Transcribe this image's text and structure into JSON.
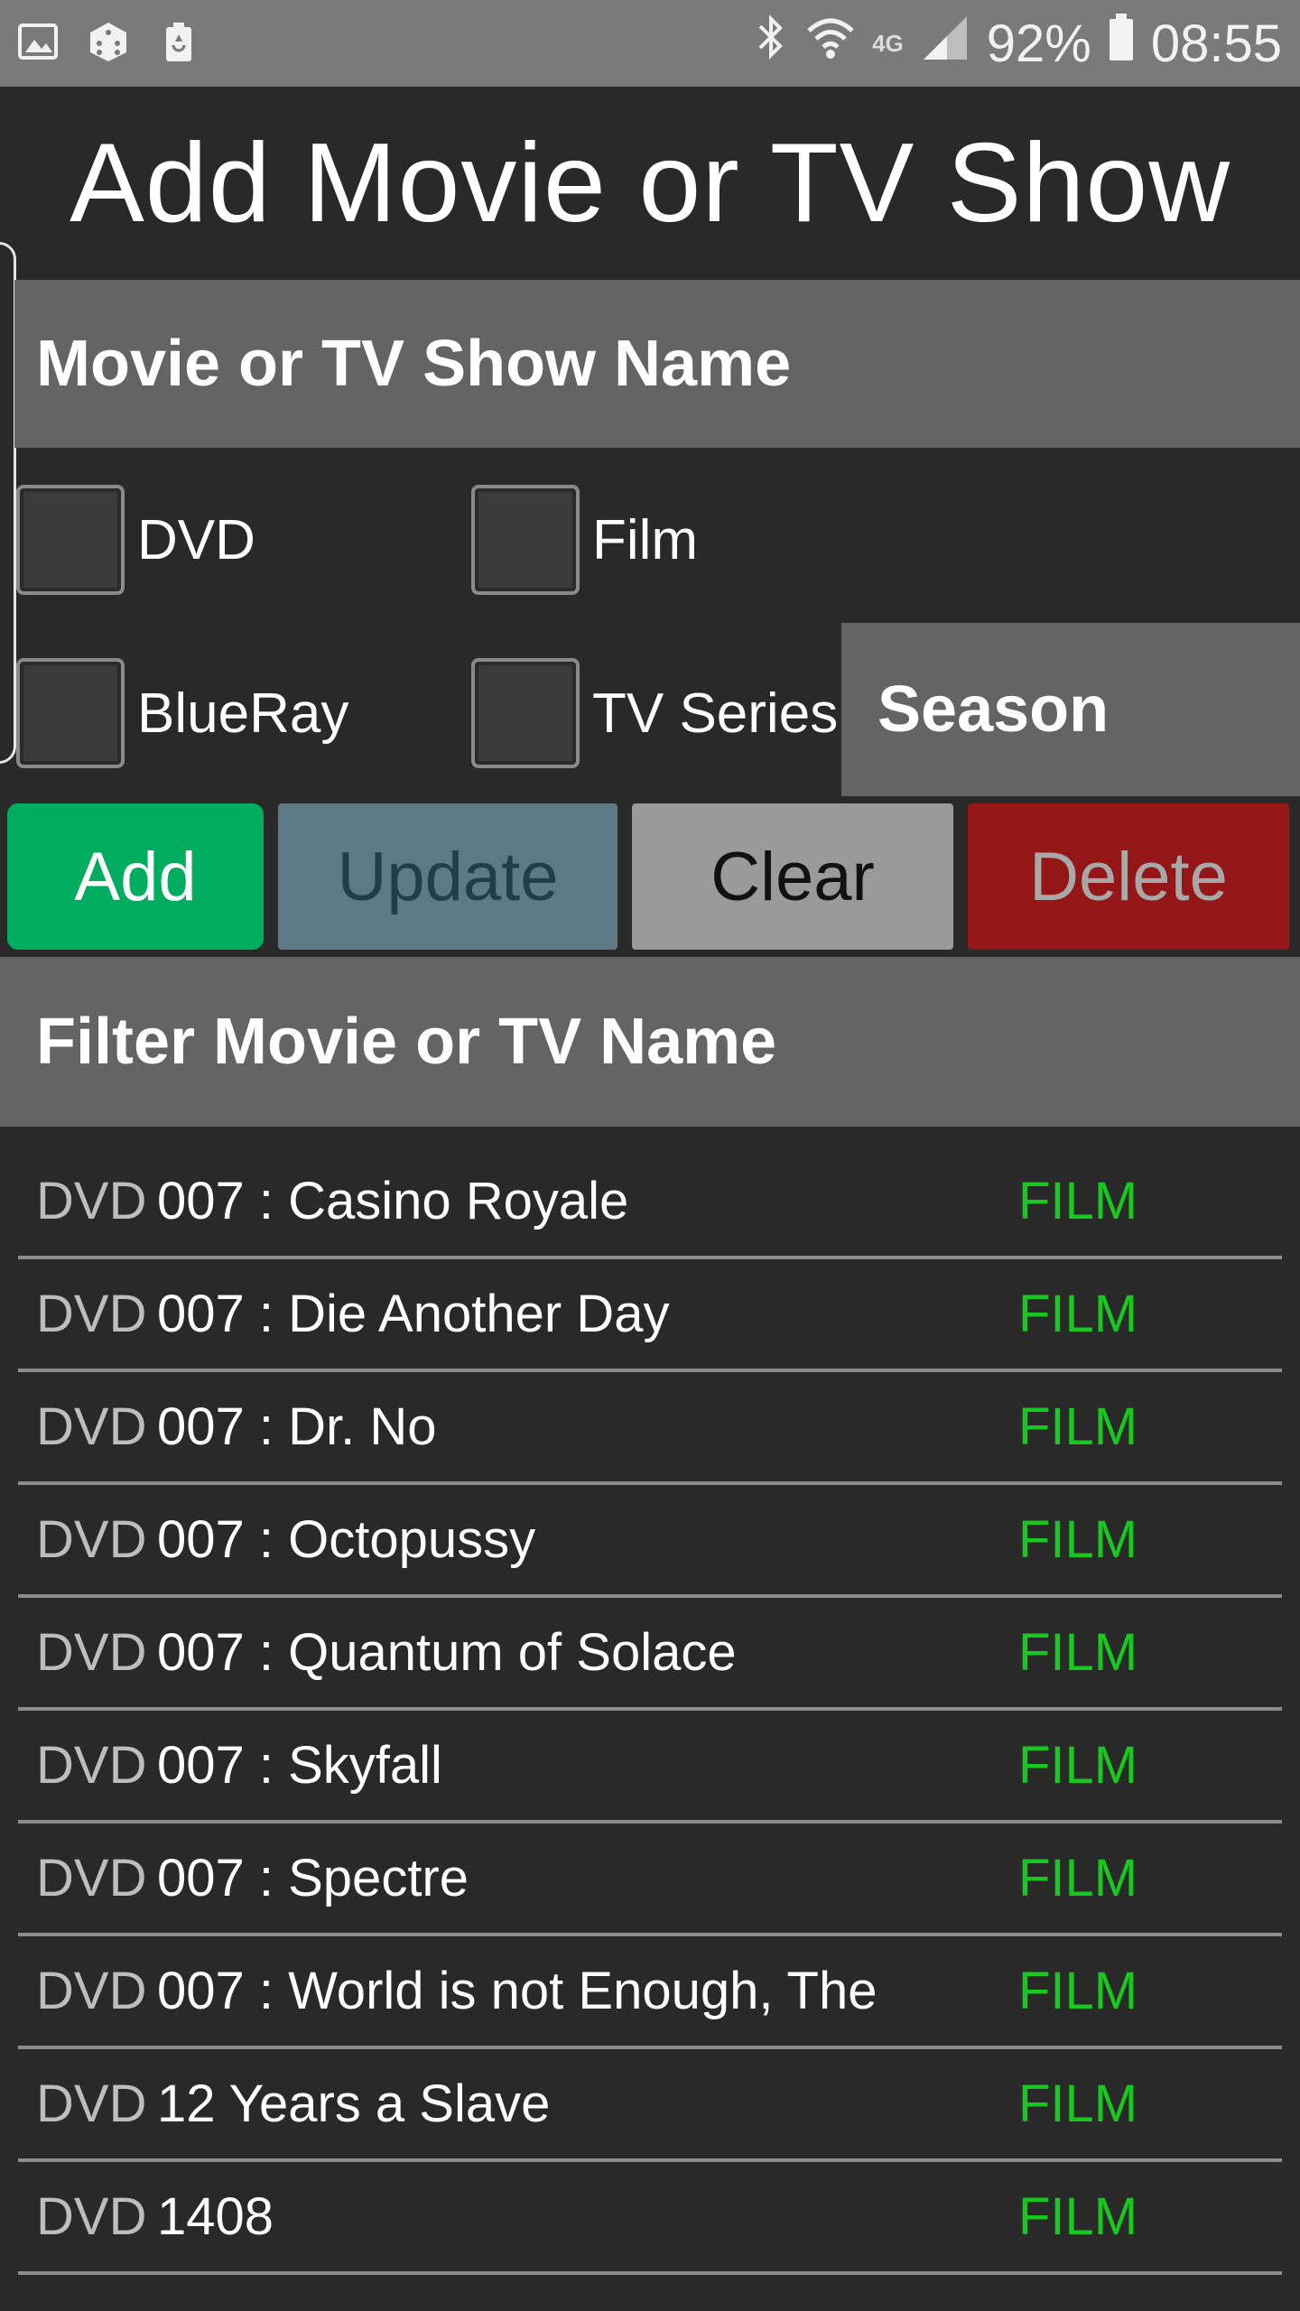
{
  "status_bar": {
    "left_icons": [
      "image-icon",
      "dice-icon",
      "battery-saver-icon"
    ],
    "network_label": "4G",
    "battery": "92%",
    "time": "08:55"
  },
  "title": "Add Movie or TV Show",
  "name_field": {
    "placeholder": "Movie or TV Show Name",
    "value": ""
  },
  "checkboxes": {
    "dvd": "DVD",
    "film": "Film",
    "blueray": "BlueRay",
    "tv_series": "TV Series"
  },
  "season_field": {
    "placeholder": "Season",
    "value": ""
  },
  "buttons": {
    "add": "Add",
    "update": "Update",
    "clear": "Clear",
    "delete": "Delete"
  },
  "filter_field": {
    "placeholder": "Filter Movie or TV Name",
    "value": ""
  },
  "list": [
    {
      "format": "DVD",
      "name": "007 : Casino Royale",
      "type": "FILM"
    },
    {
      "format": "DVD",
      "name": "007 : Die Another Day",
      "type": "FILM"
    },
    {
      "format": "DVD",
      "name": "007 : Dr. No",
      "type": "FILM"
    },
    {
      "format": "DVD",
      "name": "007 : Octopussy",
      "type": "FILM"
    },
    {
      "format": "DVD",
      "name": "007 : Quantum of Solace",
      "type": "FILM"
    },
    {
      "format": "DVD",
      "name": "007 : Skyfall",
      "type": "FILM"
    },
    {
      "format": "DVD",
      "name": "007 : Spectre",
      "type": "FILM"
    },
    {
      "format": "DVD",
      "name": "007 : World is not Enough, The",
      "type": "FILM"
    },
    {
      "format": "DVD",
      "name": "12 Years a Slave",
      "type": "FILM"
    },
    {
      "format": "DVD",
      "name": "1408",
      "type": "FILM"
    }
  ],
  "colors": {
    "background": "#292929",
    "field": "#646464",
    "add": "#00ad5e",
    "update": "#5d7a84",
    "clear": "#9a9a9a",
    "delete": "#941617",
    "film_label": "#17c81f"
  }
}
